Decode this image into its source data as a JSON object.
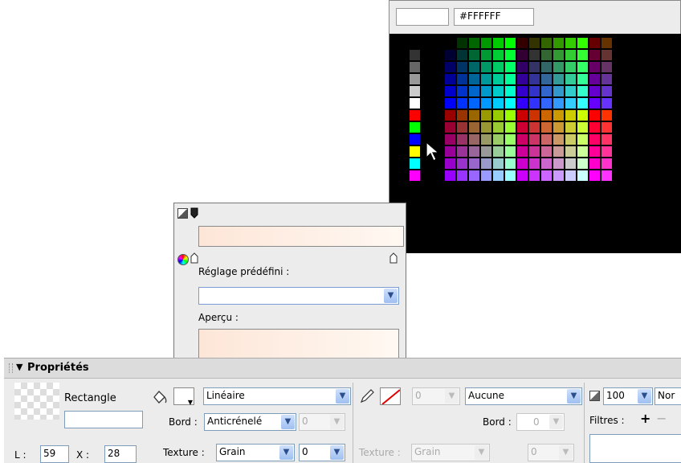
{
  "swatches": {
    "hex_value": "#FFFFFF",
    "preview_color": "#FFFFFF",
    "left_column_colors": [
      "#333333",
      "#666666",
      "#999999",
      "#CCCCCC",
      "#FFFFFF",
      "#FF0000",
      "#00FF00",
      "#0000FF",
      "#FFFF00",
      "#00FFFF",
      "#FF00FF"
    ]
  },
  "gradient_editor": {
    "preset_label": "Réglage prédéfini :",
    "preset_value": "",
    "preview_label": "Aperçu :"
  },
  "properties": {
    "title": "Propriétés",
    "object_name": "Rectangle",
    "object_name_field": "",
    "fill_type": "Linéaire",
    "edge_label": "Bord :",
    "edge_value": "Anticrénelé",
    "edge_feather": "0",
    "texture_label": "Texture :",
    "texture_value": "Grain",
    "texture_amount": "0",
    "stroke_size": "0",
    "stroke_type": "Aucune",
    "stroke_edge_label": "Bord :",
    "stroke_edge_value": "0",
    "stroke_texture_label": "Texture :",
    "stroke_texture_value": "Grain",
    "stroke_texture_amount": "0",
    "opacity": "100",
    "blend_mode": "Nor",
    "filters_label": "Filtres :",
    "w_label": "L :",
    "w_value": "59",
    "x_label": "X :",
    "x_value": "28"
  }
}
